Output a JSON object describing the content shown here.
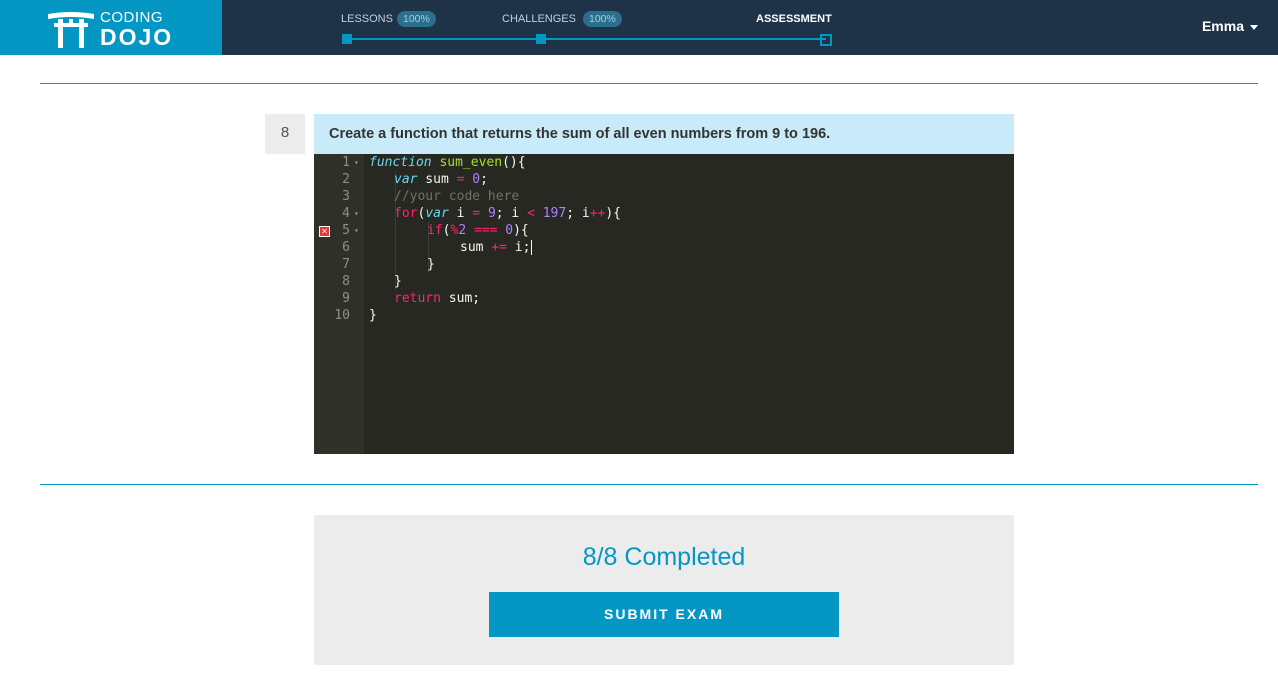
{
  "logo": {
    "top": "CODING",
    "bottom": "DOJO"
  },
  "nav": {
    "steps": [
      {
        "label": "LESSONS",
        "badge": "100%"
      },
      {
        "label": "CHALLENGES",
        "badge": "100%"
      },
      {
        "label": "ASSESSMENT"
      }
    ]
  },
  "user": {
    "name": "Emma"
  },
  "question": {
    "number": "8",
    "prompt": "Create a function that returns the sum of all even numbers from 9 to 196."
  },
  "editor": {
    "line_numbers": [
      "1",
      "2",
      "3",
      "4",
      "5",
      "6",
      "7",
      "8",
      "9",
      "10"
    ],
    "fold_markers": [
      "1",
      "4",
      "5"
    ],
    "error_line": "5",
    "lines": [
      [
        "function",
        " ",
        "sum_even",
        "(){"
      ],
      [
        "var",
        " sum ",
        "=",
        " ",
        "0",
        ";"
      ],
      [
        "//your code here"
      ],
      [
        "for",
        "(",
        "var",
        " i ",
        "=",
        " ",
        "9",
        "; i ",
        "<",
        " ",
        "197",
        "; i",
        "++",
        "){"
      ],
      [
        "if",
        "(",
        "%",
        "2",
        " ",
        "===",
        " ",
        "0",
        "){"
      ],
      [
        "sum ",
        "+=",
        " i;"
      ],
      [
        "}"
      ],
      [
        "}"
      ],
      [
        "return",
        " sum;"
      ],
      [
        "}"
      ]
    ]
  },
  "completion": {
    "status": "8/8 Completed",
    "submit_label": "SUBMIT EXAM"
  },
  "colors": {
    "accent": "#0597c4",
    "topbar": "#1f3348",
    "editor_bg": "#272822",
    "keyword": "#f92672",
    "storage": "#66d9ef",
    "function_name": "#a6e22e",
    "number": "#ae81ff",
    "comment": "#75715e"
  }
}
